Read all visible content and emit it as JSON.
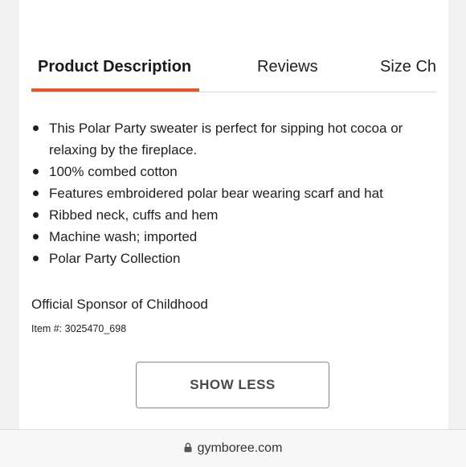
{
  "tabs": [
    {
      "label": "Product Description",
      "active": true
    },
    {
      "label": "Reviews",
      "active": false
    },
    {
      "label": "Size Ch",
      "active": false
    }
  ],
  "accent_color": "#e2582b",
  "description": {
    "bullets": [
      "This Polar Party sweater is perfect for sipping hot cocoa or relaxing by the fireplace.",
      "100% combed cotton",
      "Features embroidered polar bear wearing scarf and hat",
      "Ribbed neck, cuffs and hem",
      "Machine wash; imported",
      "Polar Party Collection"
    ],
    "sponsor": "Official Sponsor of Childhood",
    "item_number": "Item #: 3025470_698"
  },
  "show_less_label": "SHOW LESS",
  "address_bar": {
    "icon": "lock-icon",
    "url": "gymboree.com"
  }
}
